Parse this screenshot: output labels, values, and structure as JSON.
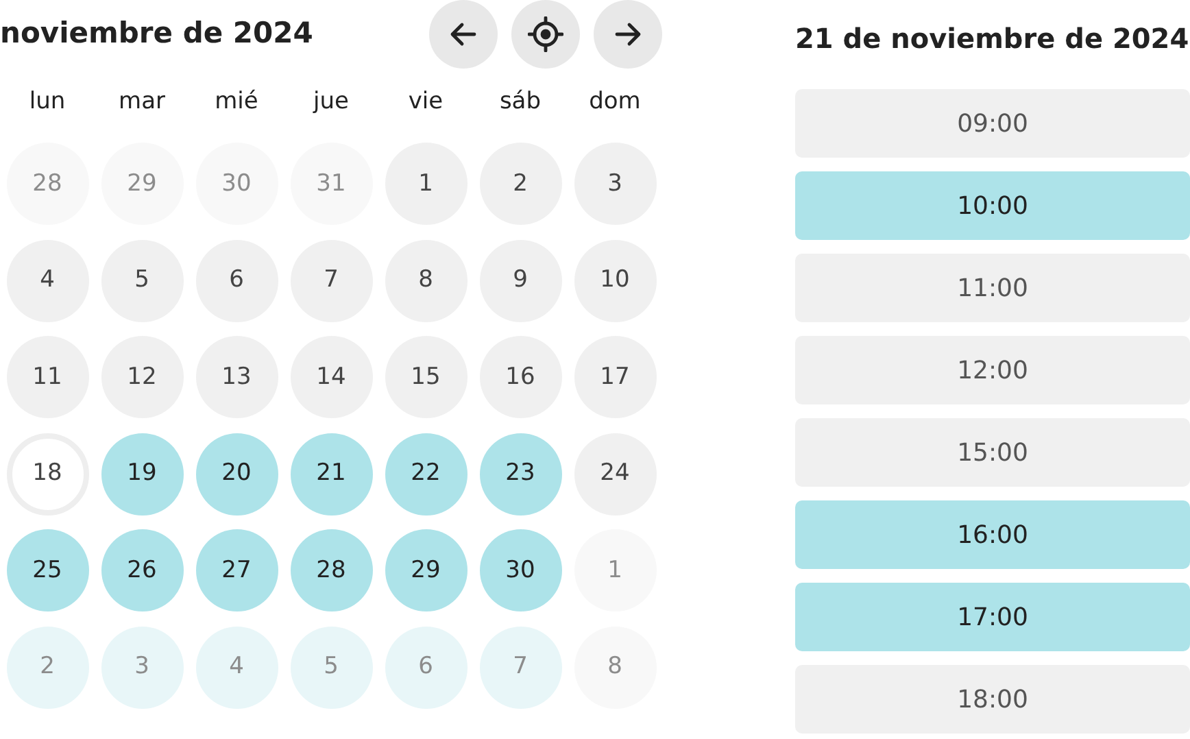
{
  "calendar": {
    "title": "noviembre de 2024",
    "weekdays": [
      "lun",
      "mar",
      "mié",
      "jue",
      "vie",
      "sáb",
      "dom"
    ],
    "days": [
      {
        "label": "28",
        "outside": true,
        "available": false,
        "today": false
      },
      {
        "label": "29",
        "outside": true,
        "available": false,
        "today": false
      },
      {
        "label": "30",
        "outside": true,
        "available": false,
        "today": false
      },
      {
        "label": "31",
        "outside": true,
        "available": false,
        "today": false
      },
      {
        "label": "1",
        "outside": false,
        "available": false,
        "today": false
      },
      {
        "label": "2",
        "outside": false,
        "available": false,
        "today": false
      },
      {
        "label": "3",
        "outside": false,
        "available": false,
        "today": false
      },
      {
        "label": "4",
        "outside": false,
        "available": false,
        "today": false
      },
      {
        "label": "5",
        "outside": false,
        "available": false,
        "today": false
      },
      {
        "label": "6",
        "outside": false,
        "available": false,
        "today": false
      },
      {
        "label": "7",
        "outside": false,
        "available": false,
        "today": false
      },
      {
        "label": "8",
        "outside": false,
        "available": false,
        "today": false
      },
      {
        "label": "9",
        "outside": false,
        "available": false,
        "today": false
      },
      {
        "label": "10",
        "outside": false,
        "available": false,
        "today": false
      },
      {
        "label": "11",
        "outside": false,
        "available": false,
        "today": false
      },
      {
        "label": "12",
        "outside": false,
        "available": false,
        "today": false
      },
      {
        "label": "13",
        "outside": false,
        "available": false,
        "today": false
      },
      {
        "label": "14",
        "outside": false,
        "available": false,
        "today": false
      },
      {
        "label": "15",
        "outside": false,
        "available": false,
        "today": false
      },
      {
        "label": "16",
        "outside": false,
        "available": false,
        "today": false
      },
      {
        "label": "17",
        "outside": false,
        "available": false,
        "today": false
      },
      {
        "label": "18",
        "outside": false,
        "available": false,
        "today": true
      },
      {
        "label": "19",
        "outside": false,
        "available": true,
        "today": false
      },
      {
        "label": "20",
        "outside": false,
        "available": true,
        "today": false
      },
      {
        "label": "21",
        "outside": false,
        "available": true,
        "today": false
      },
      {
        "label": "22",
        "outside": false,
        "available": true,
        "today": false
      },
      {
        "label": "23",
        "outside": false,
        "available": true,
        "today": false
      },
      {
        "label": "24",
        "outside": false,
        "available": false,
        "today": false
      },
      {
        "label": "25",
        "outside": false,
        "available": true,
        "today": false
      },
      {
        "label": "26",
        "outside": false,
        "available": true,
        "today": false
      },
      {
        "label": "27",
        "outside": false,
        "available": true,
        "today": false
      },
      {
        "label": "28",
        "outside": false,
        "available": true,
        "today": false
      },
      {
        "label": "29",
        "outside": false,
        "available": true,
        "today": false
      },
      {
        "label": "30",
        "outside": false,
        "available": true,
        "today": false
      },
      {
        "label": "1",
        "outside": true,
        "available": false,
        "today": false
      },
      {
        "label": "2",
        "outside": true,
        "available": true,
        "today": false
      },
      {
        "label": "3",
        "outside": true,
        "available": true,
        "today": false
      },
      {
        "label": "4",
        "outside": true,
        "available": true,
        "today": false
      },
      {
        "label": "5",
        "outside": true,
        "available": true,
        "today": false
      },
      {
        "label": "6",
        "outside": true,
        "available": true,
        "today": false
      },
      {
        "label": "7",
        "outside": true,
        "available": true,
        "today": false
      },
      {
        "label": "8",
        "outside": true,
        "available": false,
        "today": false
      }
    ]
  },
  "schedule": {
    "title": "21 de noviembre de 2024",
    "slots": [
      {
        "time": "09:00",
        "highlighted": false
      },
      {
        "time": "10:00",
        "highlighted": true
      },
      {
        "time": "11:00",
        "highlighted": false
      },
      {
        "time": "12:00",
        "highlighted": false
      },
      {
        "time": "15:00",
        "highlighted": false
      },
      {
        "time": "16:00",
        "highlighted": true
      },
      {
        "time": "17:00",
        "highlighted": true
      },
      {
        "time": "18:00",
        "highlighted": false
      }
    ]
  }
}
